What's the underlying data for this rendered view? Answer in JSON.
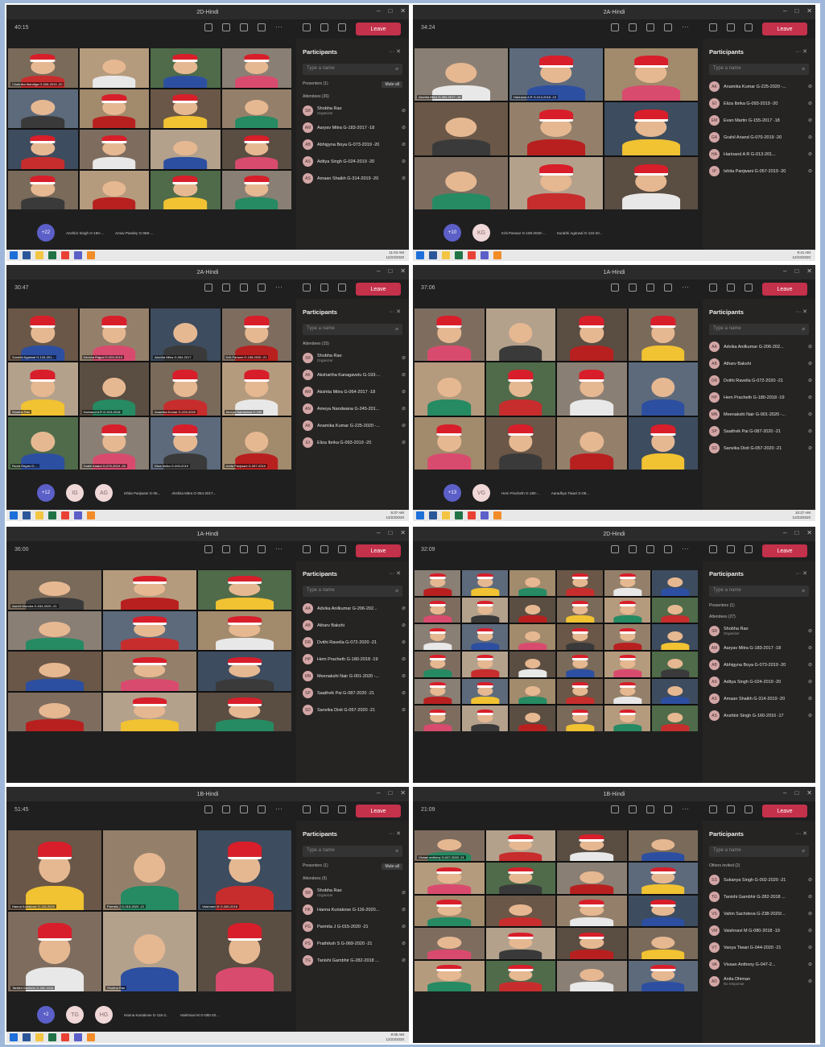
{
  "colors": {
    "teams_dark": "#1f1f1f",
    "leave_red": "#c4314b",
    "accent": "#5b5fc7",
    "page_bg": "#9fb8da"
  },
  "common": {
    "leave_label": "Leave",
    "participants_title": "Participants",
    "search_placeholder": "Type a name",
    "mute_all_label": "Mute all",
    "icons": [
      "people-icon",
      "chat-icon",
      "raise-hand-icon",
      "share-icon",
      "more-icon",
      "camera-icon",
      "mic-icon",
      "share-screen-icon"
    ],
    "taskbar_icons": [
      "windows-icon",
      "word-icon",
      "explorer-icon",
      "excel-icon",
      "chrome-icon",
      "teams-icon",
      "vlc-icon"
    ]
  },
  "windows": [
    {
      "title": "2D-Hindi",
      "timer": "40:15",
      "clock": [
        "11:04 AM",
        "12/23/2020"
      ],
      "bottom_badges": [
        "+22"
      ],
      "bottom_labels": [
        "Anshbir Singh G-160-...",
        "Arnav Pandey G-068-..."
      ],
      "sections": [
        "Presenters (1)",
        "Attendees (26)"
      ],
      "people": [
        {
          "ini": "SR",
          "name": "Shobha Rao",
          "sub": "Organizer"
        },
        {
          "ini": "AM",
          "name": "Aaryav Mitra G-183-2017 -18"
        },
        {
          "ini": "AB",
          "name": "Abhigyna Boya G-073-2019 -20"
        },
        {
          "ini": "AS",
          "name": "Aditya Singh G-024-2019 -20"
        },
        {
          "ini": "AS",
          "name": "Amaan Shaikh G-314-2019 -20"
        }
      ],
      "tiles": [
        "Chaitnika Mandiga G-006-2019 -20"
      ]
    },
    {
      "title": "2A-Hindi",
      "timer": "34:24",
      "clock": [
        "9:41 AM",
        "12/23/2020"
      ],
      "bottom_badges": [
        "+10",
        "KG"
      ],
      "bottom_labels": [
        "Kriti Panwar G-158-2020-...",
        "Surabhi Agarwal G-134-20..."
      ],
      "sections": [],
      "people": [
        {
          "ini": "AK",
          "name": "Anamika Kumar G-225-2020 -..."
        },
        {
          "ini": "EI",
          "name": "Eliza Ibrika G-093-2019 -20"
        },
        {
          "ini": "EM",
          "name": "Evan Martin G-155-2017 -18"
        },
        {
          "ini": "GA",
          "name": "Grahil Anand G-070-2019 -20"
        },
        {
          "ini": "HA",
          "name": "Harinand A R G-013-201..."
        },
        {
          "ini": "IP",
          "name": "Ishita Panjwani G-057-2019 -20"
        }
      ],
      "tiles": [
        "Akshita Mitra G-064-2017 -18",
        "Harinand A R G-013-2018 -19"
      ]
    },
    {
      "title": "2A-Hindi",
      "timer": "30:47",
      "clock": [
        "9:37 AM",
        "12/23/2020"
      ],
      "bottom_badges": [
        "+12",
        "IG",
        "AG"
      ],
      "bottom_labels": [
        "Ishita Panjwani G-05...",
        "Akshita Mitra G-064-2017..."
      ],
      "sections": [
        "Attendees (15)"
      ],
      "people": [
        {
          "ini": "SR",
          "name": "Shobha Rao",
          "sub": "Organizer"
        },
        {
          "ini": "AK",
          "name": "Akshartha Kanagavelu G-193-..."
        },
        {
          "ini": "AM",
          "name": "Akshita Mitra G-064-2017 -18"
        },
        {
          "ini": "AN",
          "name": "Ameya Nandwana G-245-201..."
        },
        {
          "ini": "AK",
          "name": "Anamika Kumar G-225-2020 -..."
        },
        {
          "ini": "EI",
          "name": "Eliza Ibrika G-093-2019 -20"
        }
      ],
      "tiles": [
        "Surabhi Agarwal G-134-201...",
        "Keesha Rajpal G-003-2019",
        "Akshita Mitra G-064-2017",
        "Kriti Panwar G-158-2020 -21",
        "Shobha Rao",
        "Harinand A R G-013-2018",
        "Anamika Kumar G-225-2020",
        "Ameya Nandwana G-245",
        "Ruvia Rayan G-...",
        "Grahil Anand G-070-2019 -20",
        "Eliza Ibrika G-093-2019",
        "Ishita Panjwani G-057-2019"
      ]
    },
    {
      "title": "1A-Hindi",
      "timer": "37:06",
      "clock": [
        "10:27 AM",
        "12/23/2020"
      ],
      "bottom_badges": [
        "+13",
        "VG"
      ],
      "bottom_labels": [
        "Hem Pracheth G-180-...",
        "Aaradhya Tiwari G-08..."
      ],
      "sections": [],
      "people": [
        {
          "ini": "AA",
          "name": "Advika Anilkumar G-206-202..."
        },
        {
          "ini": "AB",
          "name": "Atharv Bakshi"
        },
        {
          "ini": "DR",
          "name": "Dvithi Ravella G-072-2020 -21"
        },
        {
          "ini": "HP",
          "name": "Hem Pracheth G-180-2018 -19"
        },
        {
          "ini": "MN",
          "name": "Meenakshi Nair G-001-2020 -..."
        },
        {
          "ini": "SP",
          "name": "Saathvik Pai G-087-2020 -21"
        },
        {
          "ini": "SD",
          "name": "Sanvika Dixit G-057-2020 -21"
        }
      ],
      "tiles": []
    },
    {
      "title": "1A-Hindi",
      "timer": "36:00",
      "clock": [],
      "bottom_badges": [],
      "bottom_labels": [],
      "sections": [],
      "people": [
        {
          "ini": "AA",
          "name": "Advika Anilkumar G-206-202..."
        },
        {
          "ini": "AB",
          "name": "Atharv Bakshi"
        },
        {
          "ini": "DR",
          "name": "Dvithi Ravella G-072-2020 -21"
        },
        {
          "ini": "HP",
          "name": "Hem Pracheth G-180-2018 -19"
        },
        {
          "ini": "MN",
          "name": "Meenakshi Nair G-001-2020 -..."
        },
        {
          "ini": "SP",
          "name": "Saathvik Pai G-087-2020 -21"
        },
        {
          "ini": "SD",
          "name": "Sanvika Dixit G-057-2020 -21"
        }
      ],
      "tiles": [
        "Aarohi Mundra G-034-2020 -21"
      ]
    },
    {
      "title": "2D-Hindi",
      "timer": "32:09",
      "clock": [],
      "bottom_badges": [],
      "bottom_labels": [],
      "sections": [
        "Presenters (1)",
        "Attendees (27)"
      ],
      "people": [
        {
          "ini": "SR",
          "name": "Shobha Rao",
          "sub": "Organizer"
        },
        {
          "ini": "AM",
          "name": "Aaryav Mitra G-183-2017 -18"
        },
        {
          "ini": "AB",
          "name": "Abhigyna Boya G-073-2019 -20"
        },
        {
          "ini": "AS",
          "name": "Aditya Singh G-024-2019 -20"
        },
        {
          "ini": "AS",
          "name": "Amaan Shaikh G-314-2019 -20"
        },
        {
          "ini": "AS",
          "name": "Anshbir Singh G-160-2016 -17"
        }
      ],
      "tiles": []
    },
    {
      "title": "1B-Hindi",
      "timer": "51:45",
      "clock": [
        "9:05 AM",
        "12/23/2020"
      ],
      "bottom_badges": [
        "+2",
        "TG",
        "HG"
      ],
      "bottom_labels": [
        "Hanna Kuriakose G-116-2...",
        "Vaishnavi M G-080-20..."
      ],
      "sections": [
        "Presenters (1)",
        "Attendees (5)"
      ],
      "people": [
        {
          "ini": "SR",
          "name": "Shobha Rao",
          "sub": "Organizer"
        },
        {
          "ini": "HK",
          "name": "Hanna Kuriakose G-116-2020..."
        },
        {
          "ini": "PG",
          "name": "Parmita J G-015-2020 -21"
        },
        {
          "ini": "PS",
          "name": "Prathiksh S G-069-2020 -21"
        },
        {
          "ini": "TG",
          "name": "Tanishi Gambhir G-282-2018 ..."
        }
      ],
      "tiles": [
        "Hanna Kuriakose G-116-2020",
        "Parmita J G-015-2020 -21",
        "Vaishnavi M G-080-2018",
        "Tanishi Gambhir G-282-2018",
        "Shobha Rao"
      ]
    },
    {
      "title": "1B-Hindi",
      "timer": "21:09",
      "clock": [],
      "bottom_badges": [],
      "bottom_labels": [],
      "sections": [
        "Others invited (2)"
      ],
      "people": [
        {
          "ini": "SS",
          "name": "Sukanya Singh G-002-2020 -21"
        },
        {
          "ini": "TG",
          "name": "Tanishi Gambhir G-282-2018 ..."
        },
        {
          "ini": "VS",
          "name": "Vahin Sachdeva G-238-2020/..."
        },
        {
          "ini": "VM",
          "name": "Vaishnavi M G-080-2018 -19"
        },
        {
          "ini": "VT",
          "name": "Vanya Tiwari G-044-2020 -21"
        },
        {
          "ini": "VA",
          "name": "Vivaan Anthony G-047-2..."
        },
        {
          "ini": "AD",
          "name": "Anita Dhiman",
          "sub": "No response"
        }
      ],
      "tiles": [
        "Vivaan anthony G-047-2020 -21"
      ]
    }
  ]
}
